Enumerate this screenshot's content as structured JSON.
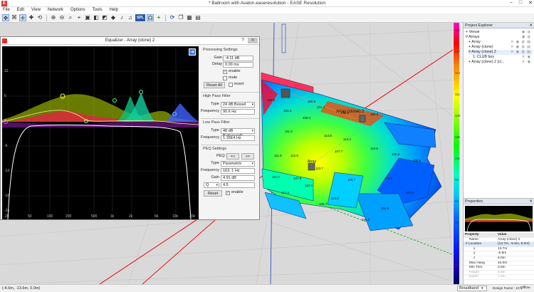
{
  "window": {
    "title": "* Ballroom with Avalon.easeresolution - EASE Resolution"
  },
  "menu": [
    "File",
    "Edit",
    "View",
    "Network",
    "Options",
    "Tools",
    "Help"
  ],
  "toolbar": {
    "spl_label": "SPL"
  },
  "equalizer": {
    "title": "Equalizer - Array (clone) 2",
    "help_label": "?",
    "close_label": "✕",
    "y_ticks": [
      "12",
      "6",
      "0",
      "-6",
      "-12",
      "-18",
      "-24"
    ],
    "x_ticks": [
      "20",
      "50",
      "100",
      "200",
      "500",
      "1k",
      "2k",
      "5k",
      "10k",
      "20k"
    ],
    "processing": {
      "heading": "Processing Settings",
      "gain_label": "Gain",
      "gain_value": "-4.11 dB",
      "delay_label": "Delay",
      "delay_value": "0.00 ms",
      "enable_label": "enable",
      "mute_label": "mute",
      "invert_label": "invert",
      "reset_all_label": "Reset All"
    },
    "high_pass": {
      "heading": "High Pass Filter",
      "type_label": "Type",
      "type_value": "24 dB Bessel",
      "freq_label": "Frequency",
      "freq_value": "90.6 Hz"
    },
    "low_pass": {
      "heading": "Low Pass Filter",
      "type_label": "Type",
      "type_value": "48 dB Butterworth",
      "freq_label": "Frequency",
      "freq_value": "1.15E4 Hz"
    },
    "peq": {
      "heading": "PEQ Settings",
      "index_label": "PEQ 3",
      "prev_label": "<<",
      "next_label": ">>",
      "type_label": "Type",
      "type_value": "Parametric",
      "freq_label": "Frequency",
      "freq_value": "163. 1 Hz",
      "gain_label": "Gain",
      "gain_value": "4.91 dB",
      "q_label": "Q",
      "q_value": "4.5",
      "reset_label": "Reset",
      "enable_label": "enable"
    }
  },
  "viewport": {
    "array_label": "Array (clone) 2",
    "array2_label": "Array",
    "spl_labels": [
      "101.4",
      "101.7",
      "108.4",
      "106.9",
      "108.3",
      "111.2",
      "114.8",
      "114.4",
      "110.6",
      "111.6",
      "106.2",
      "106.5",
      "107.7",
      "112.6",
      "111.0",
      "113.7",
      "105.7",
      "107.8",
      "110.8",
      "112.3",
      "110.8",
      "108.7",
      "107.0",
      "106.7",
      "105.8",
      "104.9",
      "110.9",
      "100.6"
    ]
  },
  "color_scale": {
    "labels": [
      "120",
      "117",
      "114",
      "111",
      "108",
      "105",
      "102",
      "99",
      "96",
      "93",
      "90",
      "87"
    ]
  },
  "project_explorer": {
    "title": "Project Explorer",
    "items": [
      {
        "label": "+ Venue",
        "indent": 0
      },
      {
        "label": "# Arrays",
        "indent": 0
      },
      {
        "label": "+ Array",
        "indent": 1
      },
      {
        "label": "+ Array (clone)",
        "indent": 1
      },
      {
        "label": "# Array (clone) 2",
        "indent": 1
      },
      {
        "label": "1: CLUB box",
        "indent": 2
      },
      {
        "label": "+ Array (clone) 2 (cl...",
        "indent": 1
      }
    ]
  },
  "properties": {
    "title": "Properties",
    "header_property": "Property",
    "header_value": "Value",
    "rows": [
      {
        "k": "Name",
        "v": "Array (clone) 2"
      },
      {
        "k": "# Location",
        "v": "(13.7m, -5.5m, 6.0m)"
      },
      {
        "k": "x",
        "v": "13.7m"
      },
      {
        "k": "y",
        "v": "-5.5m"
      },
      {
        "k": "z",
        "v": "6.0m"
      },
      {
        "k": "Max Hang",
        "v": "10.0m"
      },
      {
        "k": "Min Trim",
        "v": "3.0m"
      },
      {
        "k": "Height",
        "v": "0.0m"
      },
      {
        "k": "Depth",
        "v": "1.0m"
      }
    ]
  },
  "status": {
    "coords": "(-4.6m, -13.6m, 0.0m)",
    "mode_value": "Broadband",
    "design_factor": "Design Factor : 10:1",
    "offline": "Offline"
  }
}
